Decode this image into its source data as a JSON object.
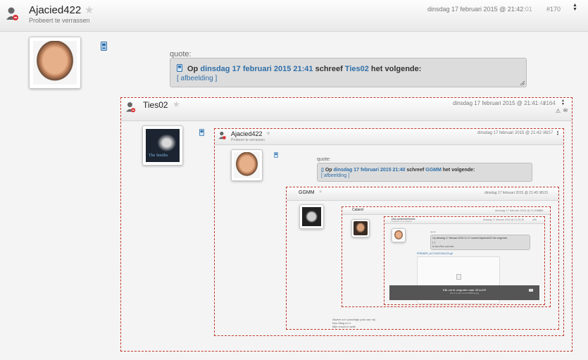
{
  "post": {
    "username": "Ajacied422",
    "subtitle": "Probeert te verrassen",
    "date_main": "dinsdag 17 februari 2015 @ 21:42",
    "date_sec": ":01",
    "post_no": "#170",
    "quote_label": "quote:",
    "quote_prefix": "Op",
    "quote_date": "dinsdag 17 februari 2015 21:41",
    "quote_mid": "schreef",
    "quote_user": "Ties02",
    "quote_suffix": "het volgende:",
    "quote_body": "[ afbeelding ]"
  },
  "nested1": {
    "username": "Ties02",
    "date_main": "dinsdag 17 februari 2015 @ 21:41",
    "date_sec": ":41",
    "post_no": "#164",
    "avatar_caption": "The Smiths"
  },
  "nested2": {
    "username": "Ajacied422",
    "subtitle": "Probeert te verrassen",
    "date_main": "dinsdag 17 februari 2015 @ 21:42",
    "date_sec": ":03",
    "post_no": "#157",
    "quote_label": "quote:",
    "quote_prefix": "Op",
    "quote_date": "dinsdag 17 februari 2015 21:40",
    "quote_mid": "schreef",
    "quote_user": "GGMM",
    "quote_suffix": "het volgende:",
    "quote_body": "[ afbeelding ]"
  },
  "nested3": {
    "username": "GGMM",
    "date_main": "dinsdag 17 februari 2015 @ 21:40",
    "date_sec": ":05",
    "post_no": "#135",
    "footer_lines": [
      "Alweer zo'n prachtige post van mij",
      "Nou Ming en 4",
      "Mijn vrouw in actie"
    ]
  },
  "nested4": {
    "username": "Caland",
    "date": "dinsdag 17 februari 2015 @ 21:30:42",
    "post_no": "#101"
  },
  "nested5": {
    "username": "DeLachendeHerrie",
    "subtitle": "Probeert te verrassen",
    "date": "dinsdag 17 februari 2015 @ 21:29:28",
    "post_no": "#96",
    "quote_label": "quote:",
    "quote_text": "Op dinsdag 17 februari 2015 21:17 schreef Ajacied422 het volgende:",
    "quote_body_a": "[..]",
    "quote_body_b": "Ik ben Ron ook niet.",
    "link": "PREMIER_ACTIVATION0123.gif",
    "overlay_text": "Klik om te vergroten naar 321x429",
    "overlay_sub": "http://i.imgur.com/nhMBtbtg.jpg"
  },
  "colors": {
    "link": "#2f6fa8",
    "dashed_border": "#c0392b",
    "header_bg": "#eeeeee",
    "quote_bg": "#dcdcdc"
  }
}
